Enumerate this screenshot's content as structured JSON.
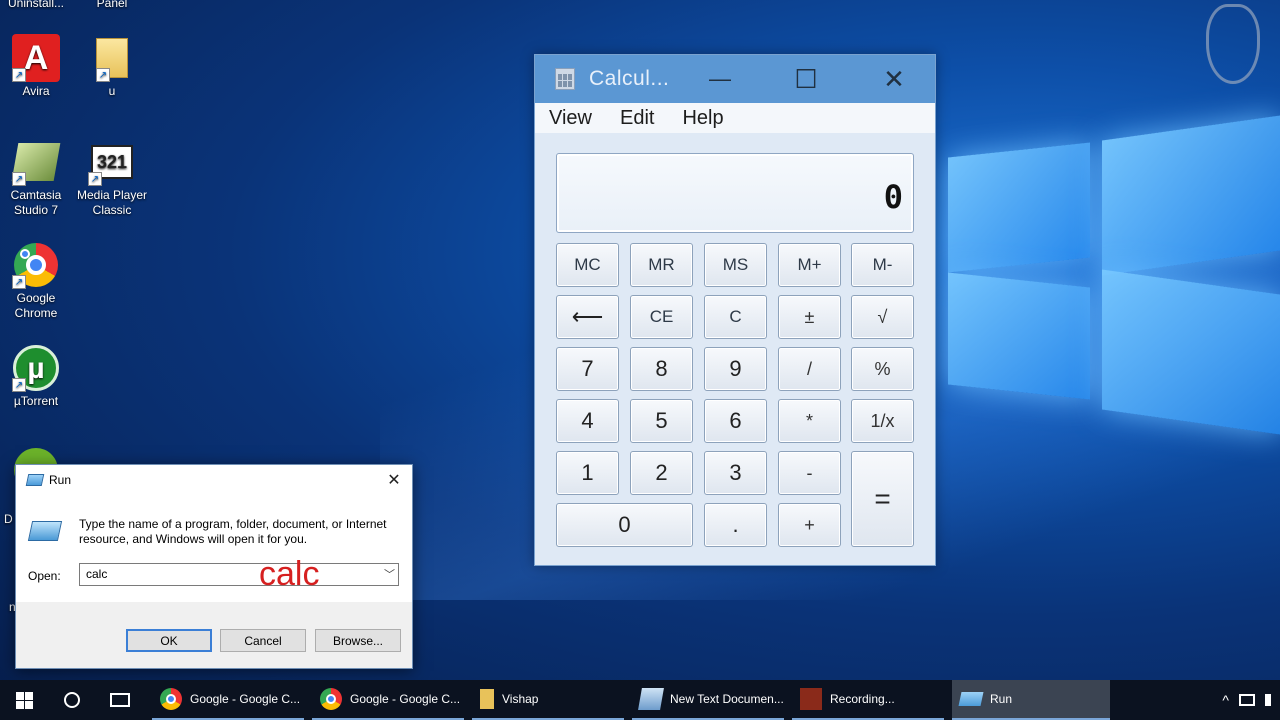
{
  "desktop": {
    "icons": [
      {
        "label": "Uninstall..."
      },
      {
        "label": "Panel"
      },
      {
        "label": "Avira"
      },
      {
        "label": "u"
      },
      {
        "label": "Camtasia Studio 7"
      },
      {
        "label": "Media Player Classic"
      },
      {
        "label": "Google Chrome"
      },
      {
        "label": "µTorrent"
      },
      {
        "label": "D"
      },
      {
        "label": "n"
      }
    ]
  },
  "calculator": {
    "title": "Calcul...",
    "minimize_glyph": "—",
    "maximize_glyph": "☐",
    "close_glyph": "✕",
    "menu": [
      "View",
      "Edit",
      "Help"
    ],
    "display_value": "0",
    "keys": {
      "mc": "MC",
      "mr": "MR",
      "ms": "MS",
      "mplus": "M+",
      "mminus": "M-",
      "backspace": "⟵",
      "ce": "CE",
      "c": "C",
      "plusminus": "±",
      "sqrt": "√",
      "seven": "7",
      "eight": "8",
      "nine": "9",
      "divide": "/",
      "percent": "%",
      "four": "4",
      "five": "5",
      "six": "6",
      "multiply": "*",
      "reciprocal": "1/x",
      "one": "1",
      "two": "2",
      "three": "3",
      "minus": "-",
      "equals": "=",
      "zero": "0",
      "decimal": ".",
      "plus": "+"
    }
  },
  "run_dialog": {
    "title": "Run",
    "close_glyph": "✕",
    "description": "Type the name of a program, folder, document, or Internet resource, and Windows will open it for you.",
    "open_label": "Open:",
    "open_value": "calc",
    "overlay_text": "calc",
    "ok_label": "OK",
    "cancel_label": "Cancel",
    "browse_label": "Browse..."
  },
  "taskbar": {
    "items": [
      {
        "label": "Google - Google C..."
      },
      {
        "label": "Google - Google C..."
      },
      {
        "label": "Vishap"
      },
      {
        "label": "New Text Documen..."
      },
      {
        "label": "Recording..."
      },
      {
        "label": "Run"
      }
    ],
    "tray_chevron": "^"
  }
}
